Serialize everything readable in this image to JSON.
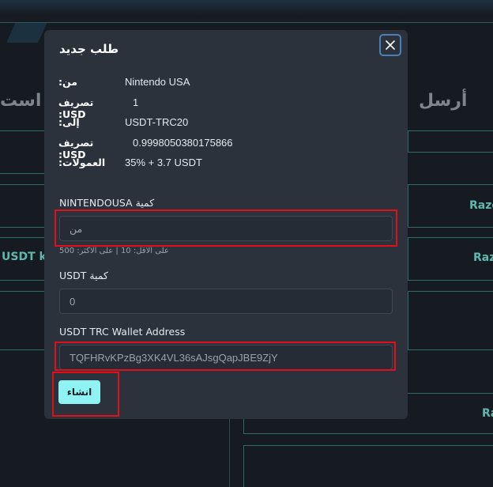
{
  "background": {
    "heading_left": "است",
    "heading_right": "أرسل",
    "side_labels": [
      "Raze",
      "Raz",
      "Ra"
    ],
    "left_label": "USDT k"
  },
  "modal": {
    "title": "طلب جديد",
    "close_icon": "close-icon",
    "info": [
      {
        "label": "من:",
        "value": "Nintendo USA"
      },
      {
        "label": "تصريف USD:",
        "value": "1"
      },
      {
        "label": "إلى:",
        "value": "USDT-TRC20"
      },
      {
        "label": "تصريف USD:",
        "value": "0.9998050380175866"
      },
      {
        "label": "العمولات:",
        "value": "35% + 3.7 USDT"
      }
    ],
    "amount_from": {
      "label": "NINTENDOUSA كمية",
      "placeholder": "من",
      "hint": "على الاقل: 10 | على الاكثر: 500"
    },
    "amount_to": {
      "label": "USDT كمية",
      "value": "0"
    },
    "wallet": {
      "label": "USDT TRC Wallet Address",
      "value": "TQFHRvKPzBg3XK4VL36sAJsgQapJBE9ZjY"
    },
    "create_button": "انشاء"
  },
  "colors": {
    "accent": "#8ff3f3",
    "modal_bg": "#2b323c",
    "highlight": "#e0101a",
    "close_border": "#4c7fb8"
  }
}
